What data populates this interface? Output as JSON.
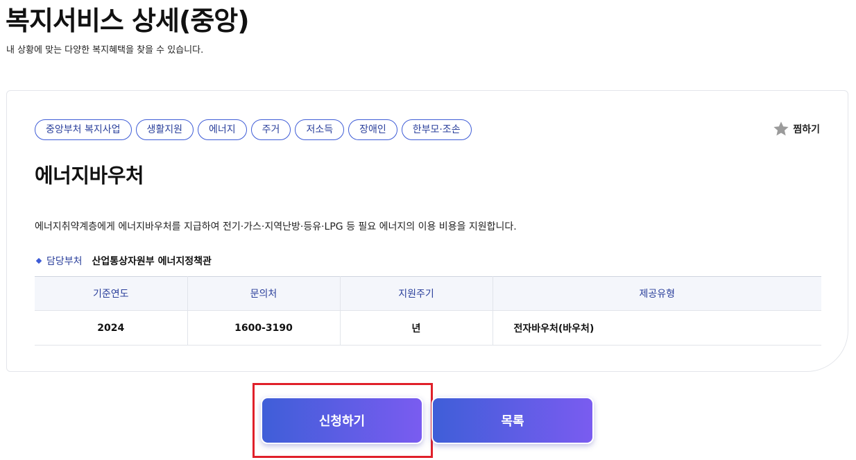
{
  "page": {
    "title": "복지서비스 상세(중앙)",
    "subtitle": "내 상황에 맞는 다양한 복지혜택을 찾을 수 있습니다."
  },
  "tags": [
    "중앙부처 복지사업",
    "생활지원",
    "에너지",
    "주거",
    "저소득",
    "장애인",
    "한부모·조손"
  ],
  "bookmark": {
    "label": "찜하기",
    "icon": "star-icon"
  },
  "service": {
    "title": "에너지바우처",
    "description": "에너지취약계층에게 에너지바우처를 지급하여 전기·가스·지역난방·등유·LPG 등 필요 에너지의 이용 비용을 지원합니다.",
    "dept_label": "담당부처",
    "dept_value": "산업통상자원부 에너지정책관"
  },
  "table": {
    "headers": [
      "기준연도",
      "문의처",
      "지원주기",
      "제공유형"
    ],
    "row": [
      "2024",
      "1600-3190",
      "년",
      "전자바우처(바우처)"
    ]
  },
  "buttons": {
    "apply": "신청하기",
    "list": "목록"
  },
  "colors": {
    "accent": "#3d5bd6",
    "gradient_start": "#3f5ed8",
    "gradient_end": "#7a5cf0",
    "highlight": "#e0202a"
  }
}
